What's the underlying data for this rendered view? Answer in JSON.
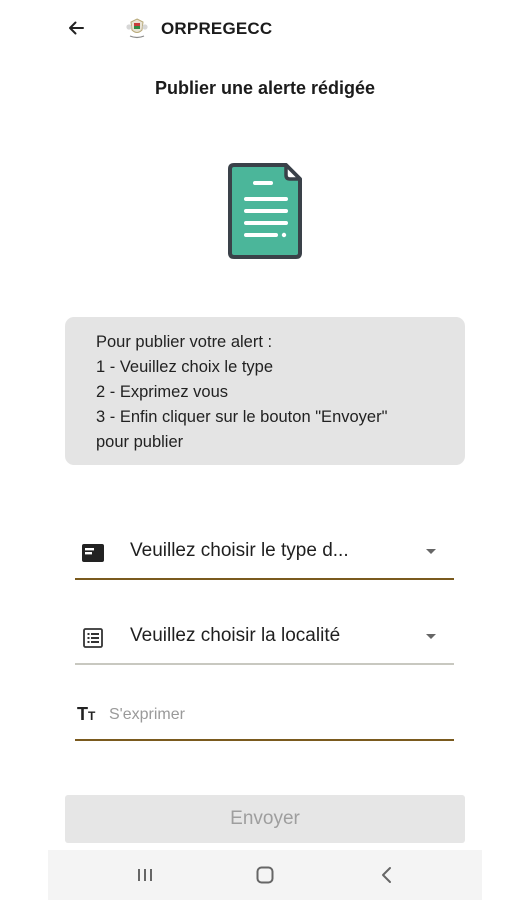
{
  "app": {
    "title": "ORPREGECC"
  },
  "page": {
    "title": "Publier une alerte rédigée"
  },
  "instructions": {
    "lines": [
      "Pour publier votre alert :",
      "1 - Veuillez choix le type",
      "2 - Exprimez vous",
      "3 - Enfin cliquer sur le bouton \"Envoyer\"",
      "pour publier"
    ]
  },
  "form": {
    "type_select": {
      "value": "Veuillez choisir le type d...",
      "icon": "card-icon"
    },
    "locality_select": {
      "value": "Veuillez choisir la localité",
      "icon": "list-icon"
    },
    "express_input": {
      "placeholder": "S'exprimer",
      "value": "",
      "icon": "text-size-icon"
    },
    "send_label": "Envoyer"
  },
  "colors": {
    "doc_green": "#4bb69a",
    "doc_outline": "#3a4149",
    "active_underline": "#7a5a1e",
    "info_bg": "#e4e4e4",
    "button_bg": "#e6e6e6",
    "button_text": "#9e9e9e"
  }
}
